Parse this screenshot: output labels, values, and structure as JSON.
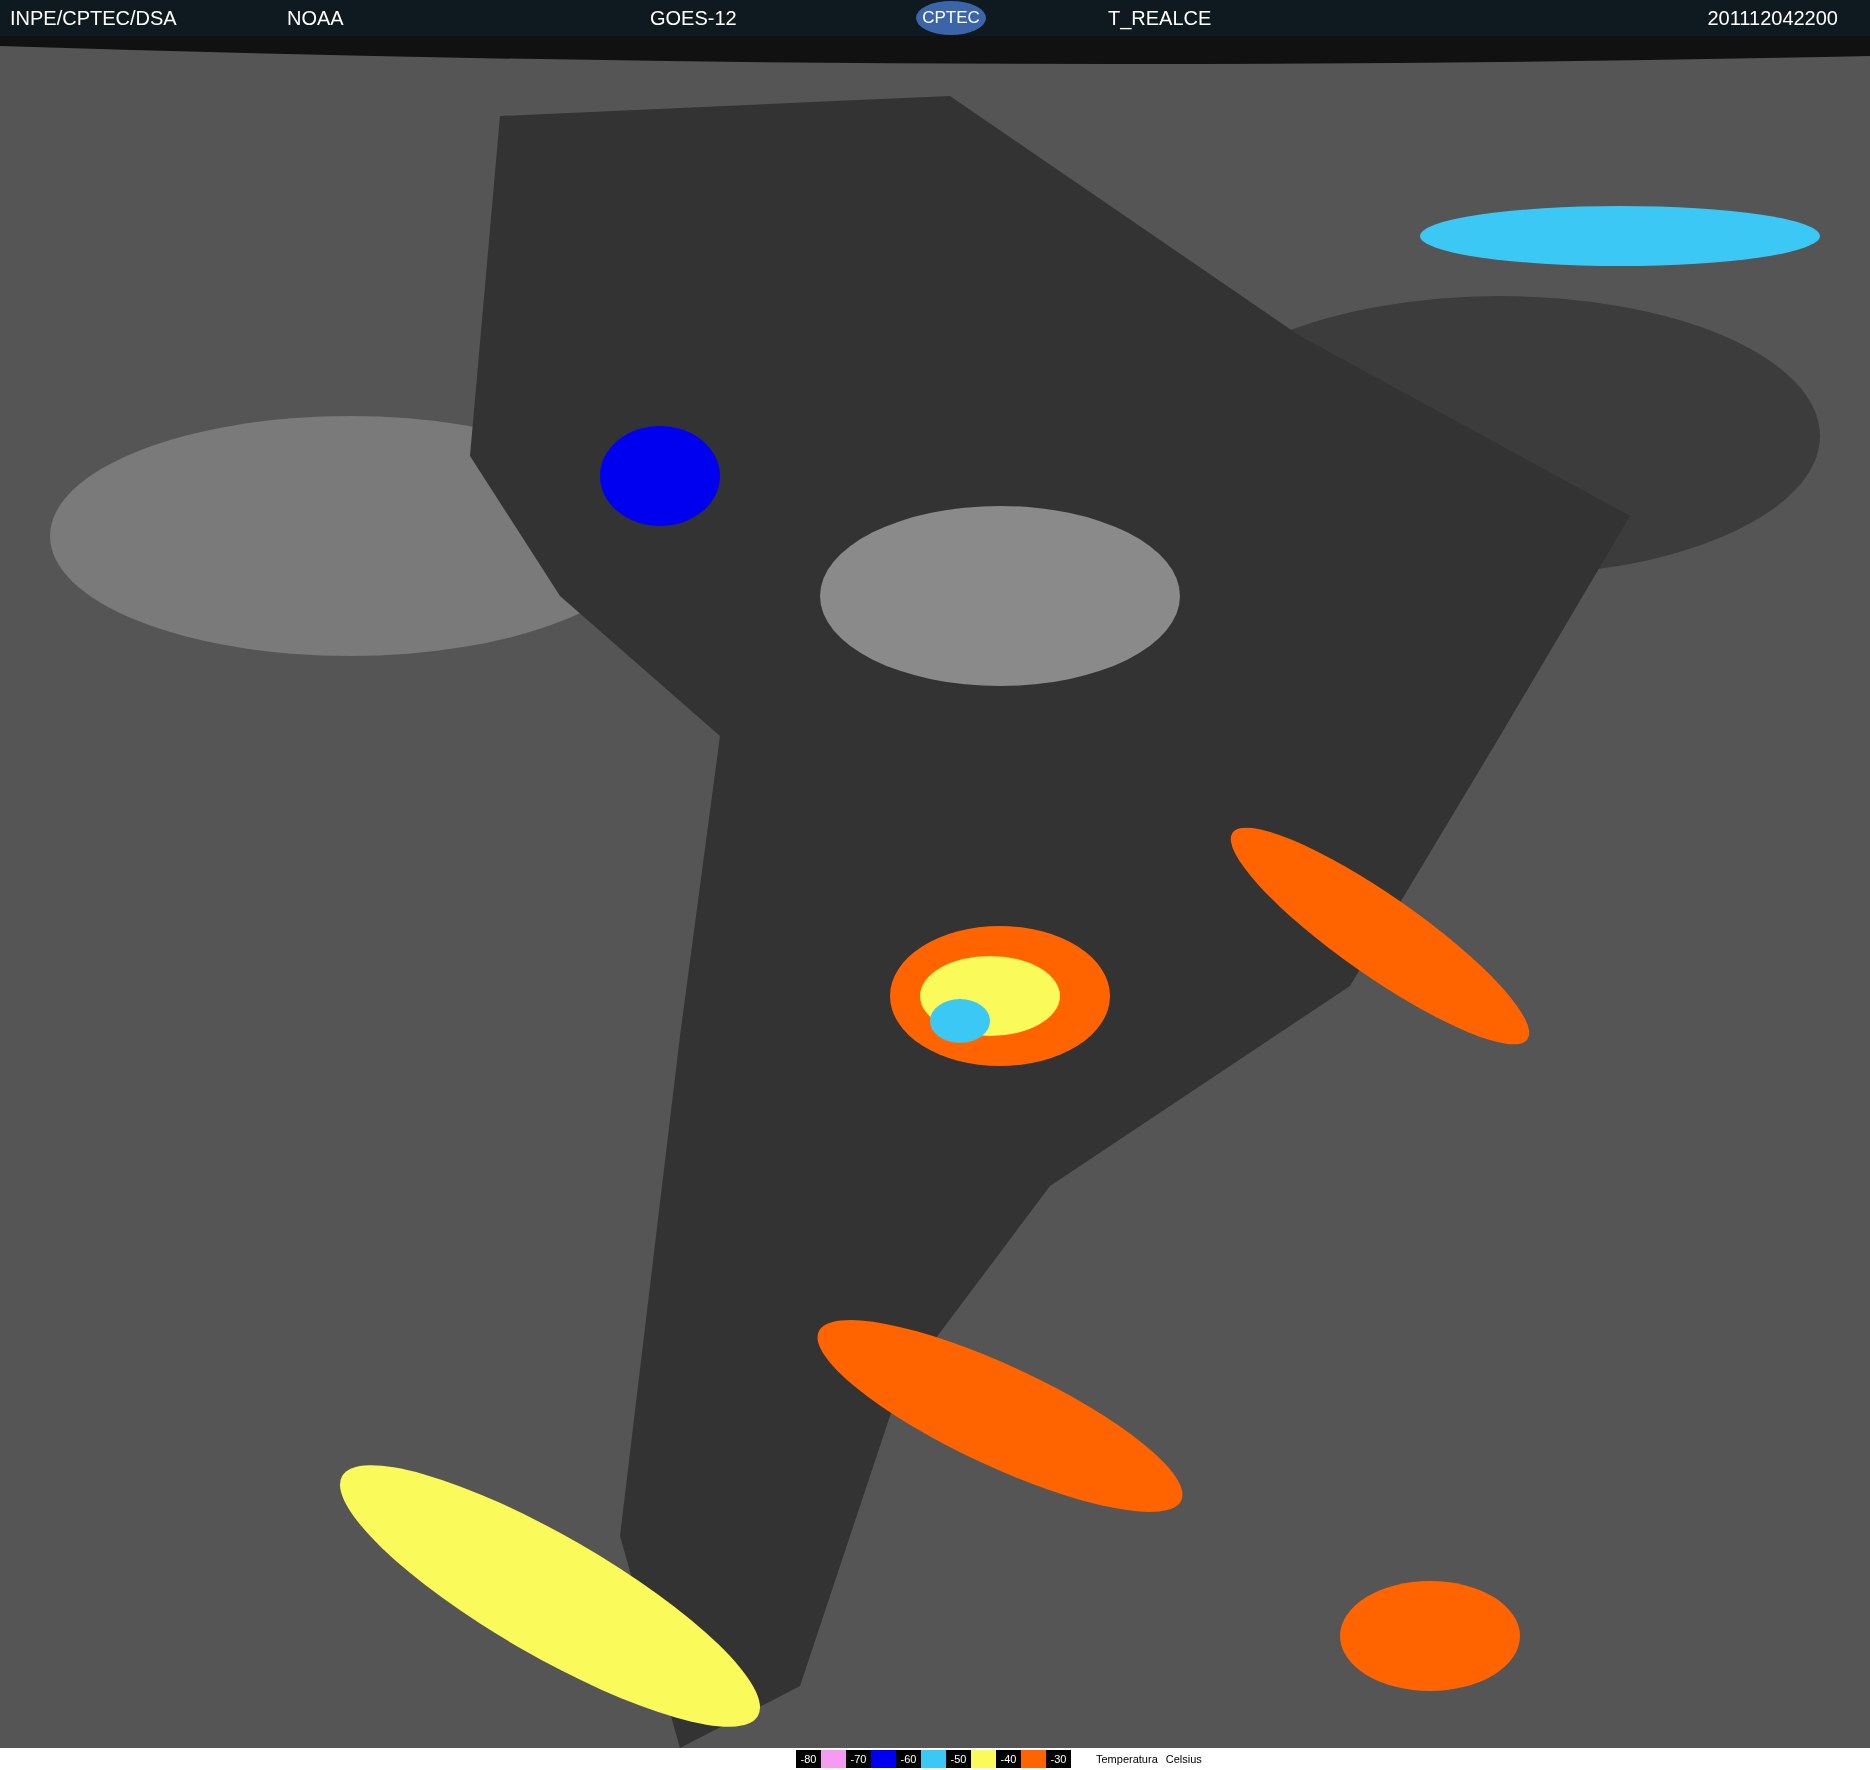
{
  "header": {
    "source": "INPE/CPTEC/DSA",
    "agency": "NOAA",
    "satellite": "GOES-12",
    "logo": "CPTEC",
    "product": "T_REALCE",
    "timestamp": "201112042200"
  },
  "legend": {
    "items": [
      {
        "label": "-80",
        "color": "#f59cf2"
      },
      {
        "label": "-70",
        "color": "#0000f0"
      },
      {
        "label": "-60",
        "color": "#3cc8f5"
      },
      {
        "label": "-50",
        "color": "#fafa5a"
      },
      {
        "label": "-40",
        "color": "#ff6400"
      }
    ],
    "last_label": "-30",
    "title": "Temperatura",
    "unit": "Celsius"
  }
}
